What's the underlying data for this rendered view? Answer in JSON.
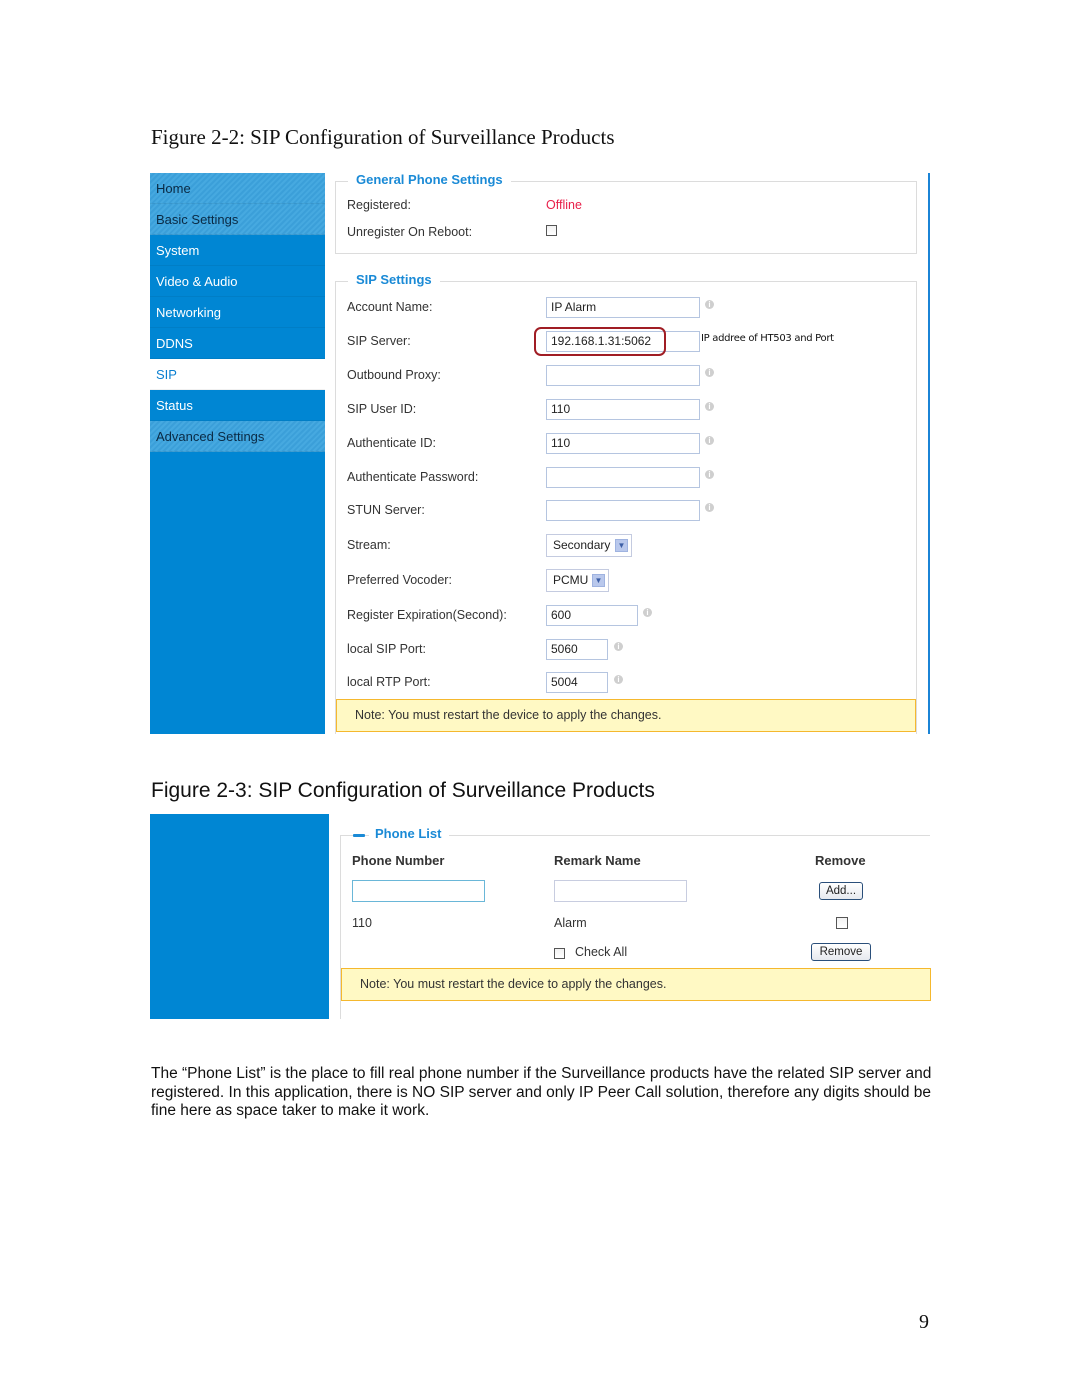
{
  "figure1": {
    "caption": "Figure 2-2:  SIP Configuration of Surveillance Products",
    "sidebar": [
      {
        "label": "Home",
        "type": "section"
      },
      {
        "label": "Basic Settings",
        "type": "section"
      },
      {
        "label": "System",
        "type": "item"
      },
      {
        "label": "Video & Audio",
        "type": "item"
      },
      {
        "label": "Networking",
        "type": "item"
      },
      {
        "label": "DDNS",
        "type": "item"
      },
      {
        "label": "SIP",
        "type": "active"
      },
      {
        "label": "Status",
        "type": "item"
      },
      {
        "label": "Advanced Settings",
        "type": "section"
      }
    ],
    "general": {
      "legend": "General Phone Settings",
      "registered_label": "Registered:",
      "registered_value": "Offline",
      "registered_color": "#e8204a",
      "unregister_label": "Unregister On Reboot:",
      "unregister_checked": false
    },
    "sip": {
      "legend": "SIP Settings",
      "account_name": {
        "label": "Account Name:",
        "value": "IP Alarm"
      },
      "sip_server": {
        "label": "SIP Server:",
        "value": "192.168.1.31:5062",
        "hint": "IP addree of HT503 and Port"
      },
      "outbound_proxy": {
        "label": "Outbound Proxy:",
        "value": ""
      },
      "sip_user_id": {
        "label": "SIP User ID:",
        "value": "110"
      },
      "authenticate_id": {
        "label": "Authenticate ID:",
        "value": "110"
      },
      "authenticate_password": {
        "label": "Authenticate Password:",
        "value": ""
      },
      "stun_server": {
        "label": "STUN Server:",
        "value": ""
      },
      "stream": {
        "label": "Stream:",
        "value": "Secondary"
      },
      "vocoder": {
        "label": "Preferred Vocoder:",
        "value": "PCMU"
      },
      "register_expiration": {
        "label": "Register Expiration(Second):",
        "value": "600"
      },
      "local_sip_port": {
        "label": "local SIP Port:",
        "value": "5060"
      },
      "local_rtp_port": {
        "label": "local RTP Port:",
        "value": "5004"
      }
    },
    "note": "Note: You must restart the device to apply the changes."
  },
  "figure2": {
    "caption": "Figure 2-3:  SIP Configuration of Surveillance Products",
    "legend": "Phone List",
    "headers": {
      "phone_number": "Phone Number",
      "remark_name": "Remark Name",
      "remove": "Remove"
    },
    "new_entry": {
      "phone_number": "",
      "remark_name": ""
    },
    "add_button": "Add...",
    "rows": [
      {
        "phone_number": "110",
        "remark_name": "Alarm",
        "checked": false
      }
    ],
    "check_all_label": "Check All",
    "remove_button": "Remove",
    "note": "Note: You must restart the device to apply the changes."
  },
  "paragraph": "The “Phone List” is the place to fill real phone number if the Surveillance products have the related SIP server and registered. In this application, there is NO SIP server and only IP Peer Call solution, therefore any digits should be fine here as space taker to make it work.",
  "page_number": "9"
}
